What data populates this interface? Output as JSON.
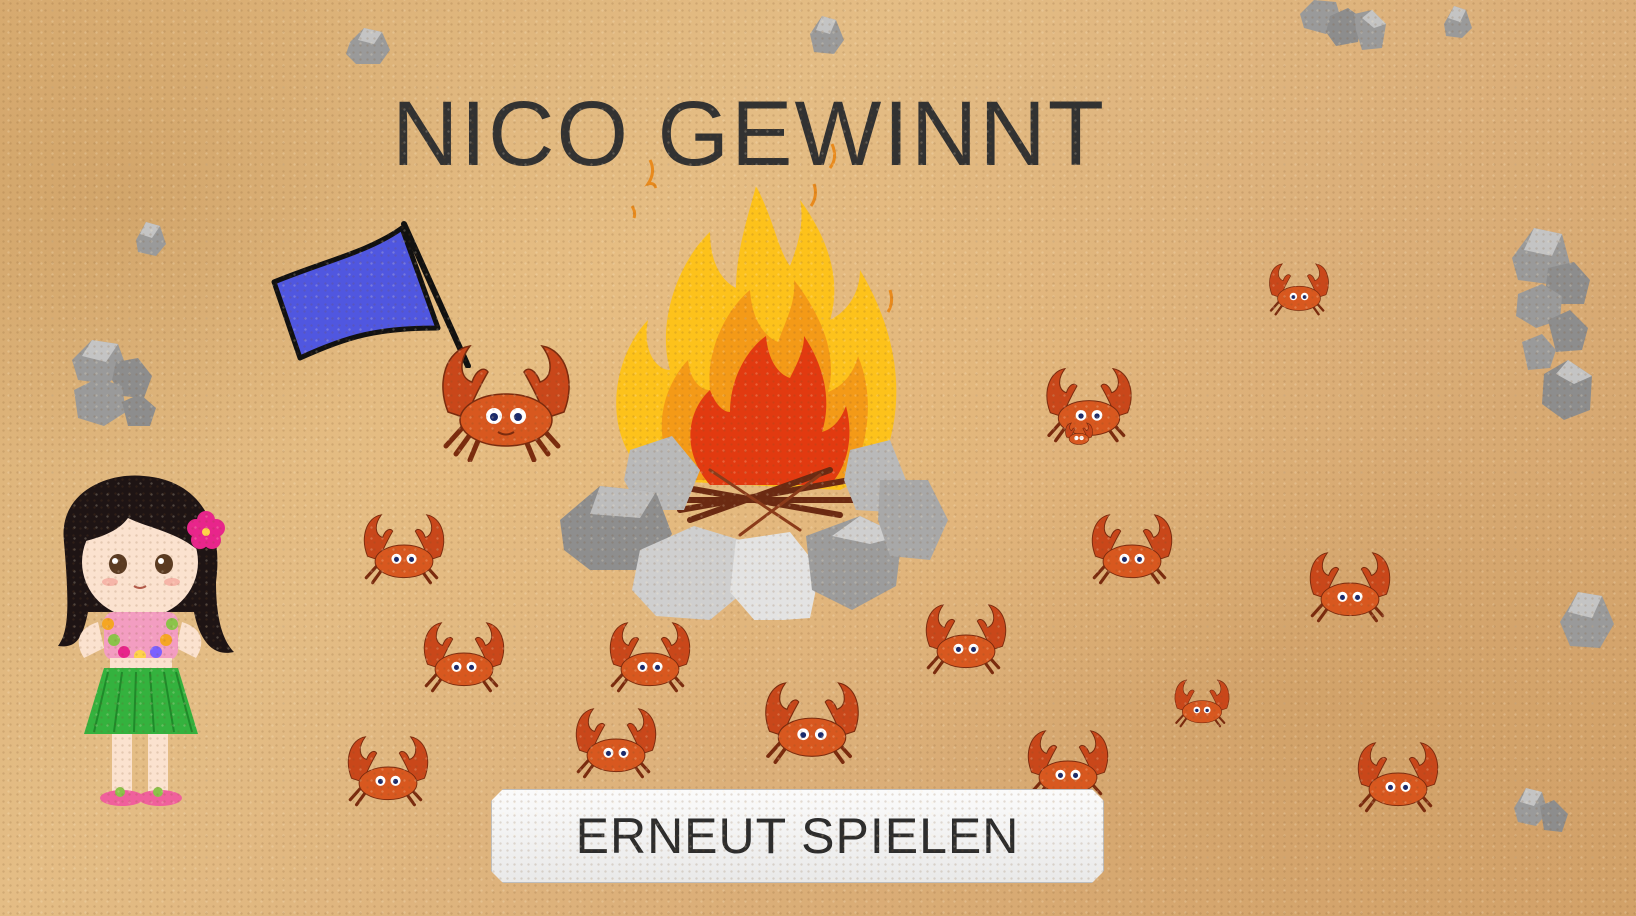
{
  "game": {
    "result_title": "NICO GEWINNT",
    "replay_label": "ERNEUT SPIELEN"
  },
  "icons": {
    "fire": "campfire-icon",
    "flag": "flag-icon",
    "crab": "crab-icon",
    "rock": "rock-icon",
    "player": "hula-girl-icon"
  },
  "colors": {
    "sand": "#e0b47c",
    "title_text": "#323232",
    "flag_blue": "#5057e0",
    "crab_orange": "#d2521e",
    "button_bg": "#f2f2f2"
  }
}
